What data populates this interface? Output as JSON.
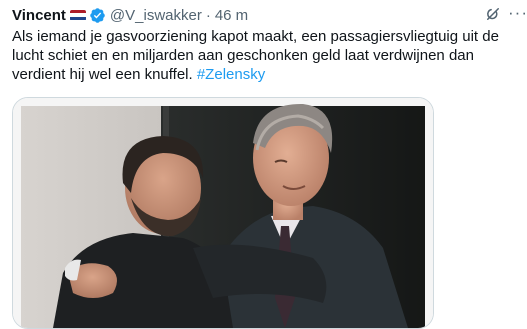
{
  "tweet": {
    "author_name": "Vincent",
    "handle": "@V_iswakker",
    "separator": "·",
    "time": "46 m",
    "text_main": "Als iemand je gasvoorziening kapot maakt, een passagiersvliegtuig uit de lucht schiet en en miljarden aan geschonken geld laat verdwijnen dan verdient hij wel een knuffel. ",
    "hashtag": "#Zelensky",
    "more_label": "···"
  },
  "icons": {
    "flag": "netherlands-flag-icon",
    "verified": "verified-badge-icon",
    "grok": "grok-icon",
    "more": "more-options-icon"
  },
  "colors": {
    "hashtag": "#1d9bf0",
    "verified": "#1d9bf0",
    "secondary_text": "#536471",
    "flag_red": "#ae1c28",
    "flag_white": "#ffffff",
    "flag_blue": "#21468b"
  }
}
